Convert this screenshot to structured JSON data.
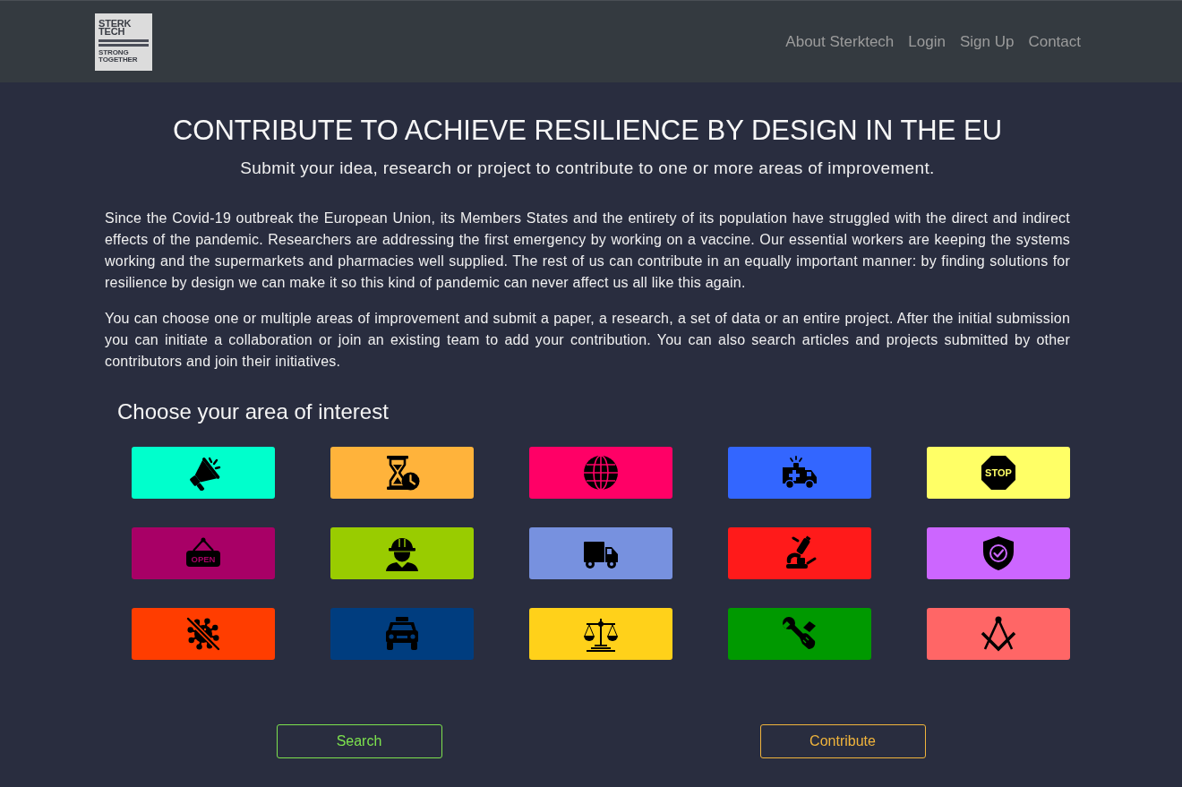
{
  "header": {
    "logo": {
      "title_lines": [
        "STERK",
        "TECH"
      ],
      "tagline": "STRONG TOGETHER"
    },
    "nav": [
      "About Sterktech",
      "Login",
      "Sign Up",
      "Contact"
    ]
  },
  "hero": {
    "title": "CONTRIBUTE TO ACHIEVE RESILIENCE BY DESIGN IN THE EU",
    "subtitle": "Submit your idea, research or project to contribute to one or more areas of improvement."
  },
  "intro": [
    "Since the Covid-19 outbreak the European Union, its Members States and the entirety of its population have struggled with the direct and indirect effects of the pandemic. Researchers are addressing the first emergency by working on a vaccine. Our essential workers are keeping the systems working and the supermarkets and pharmacies well supplied. The rest of us can contribute in an equally important manner: by finding solutions for resilience by design we can make it so this kind of pandemic can never affect us all like this again.",
    "You can choose one or multiple areas of improvement and submit a paper, a research, a set of data or an entire project. After the initial submission you can initiate a collaboration or join an existing team to add your contribution. You can also search articles and projects submitted by other contributors and join their initiatives."
  ],
  "areas": {
    "heading": "Choose your area of interest",
    "tiles": [
      {
        "color": "#00ffcc"
      },
      {
        "color": "#ffb33b"
      },
      {
        "color": "#ff0066"
      },
      {
        "color": "#3366ff"
      },
      {
        "color": "#ffff66",
        "sign_text": "STOP"
      },
      {
        "color": "#a80066",
        "sign_text": "OPEN"
      },
      {
        "color": "#99cc00"
      },
      {
        "color": "#7791df"
      },
      {
        "color": "#ff1a1a"
      },
      {
        "color": "#cc66ff"
      },
      {
        "color": "#ff3d00"
      },
      {
        "color": "#003d7f"
      },
      {
        "color": "#ffd11a"
      },
      {
        "color": "#009900"
      },
      {
        "color": "#ff6666"
      }
    ]
  },
  "actions": [
    {
      "label": "Search",
      "color": "#7de24e"
    },
    {
      "label": "Contribute",
      "color": "#f0b43c"
    }
  ]
}
